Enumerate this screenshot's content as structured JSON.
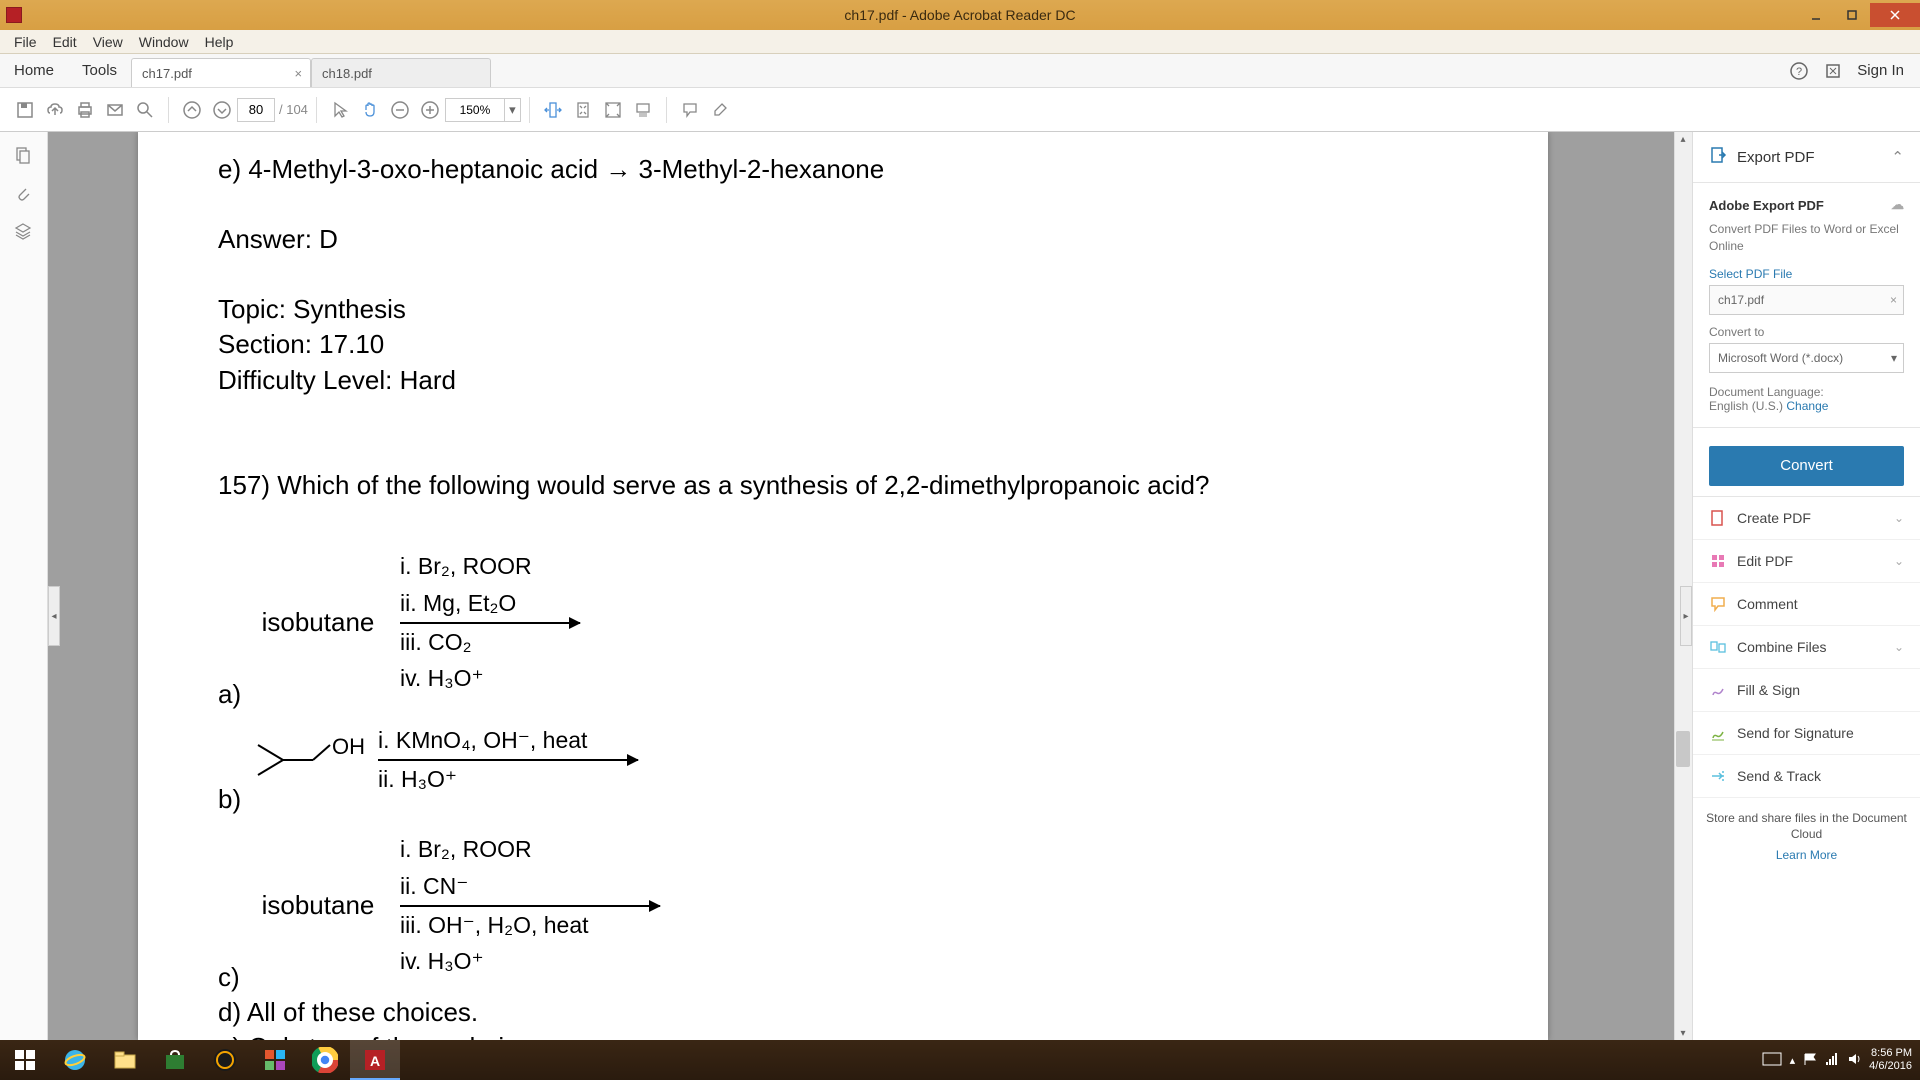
{
  "window": {
    "title": "ch17.pdf - Adobe Acrobat Reader DC"
  },
  "menubar": [
    "File",
    "Edit",
    "View",
    "Window",
    "Help"
  ],
  "tabs": {
    "home": "Home",
    "tools": "Tools",
    "docs": [
      {
        "label": "ch17.pdf",
        "active": true
      },
      {
        "label": "ch18.pdf",
        "active": false
      }
    ],
    "signin": "Sign In"
  },
  "toolbar": {
    "page_current": "80",
    "page_total": "/ 104",
    "zoom": "150%"
  },
  "document": {
    "line_e": "e) 4-Methyl-3-oxo-heptanoic acid  →  3-Methyl-2-hexanone",
    "answer": "Answer: D",
    "topic": "Topic: Synthesis",
    "section": "Section: 17.10",
    "difficulty": "Difficulty Level: Hard",
    "q157": "157) Which of the following would serve as a synthesis of 2,2-dimethylpropanoic acid?",
    "opt_a": {
      "label": "a)",
      "start": "isobutane",
      "steps_top": [
        "i. Br₂, ROOR",
        "ii. Mg, Et₂O"
      ],
      "steps_bot": [
        "iii. CO₂",
        "iv. H₃O⁺"
      ]
    },
    "opt_b": {
      "label": "b)",
      "oh": "OH",
      "steps_top": [
        "i. KMnO₄, OH⁻, heat"
      ],
      "steps_bot": [
        "ii. H₃O⁺"
      ]
    },
    "opt_c": {
      "label": "c)",
      "start": "isobutane",
      "steps_top": [
        "i.  Br₂, ROOR",
        "ii. CN⁻"
      ],
      "steps_bot": [
        "iii. OH⁻, H₂O, heat",
        "iv. H₃O⁺"
      ]
    },
    "opt_d": "d) All of these choices.",
    "opt_e": "e) Only two of these choices."
  },
  "rightpanel": {
    "export_header": "Export PDF",
    "export_title": "Adobe Export PDF",
    "export_sub": "Convert PDF Files to Word or Excel Online",
    "select_label": "Select PDF File",
    "selected_file": "ch17.pdf",
    "convert_to": "Convert to",
    "convert_format": "Microsoft Word (*.docx)",
    "doc_lang_label": "Document Language:",
    "doc_lang": "English (U.S.)",
    "change": "Change",
    "convert_btn": "Convert",
    "tools": [
      {
        "label": "Create PDF",
        "color": "#d9534f",
        "chev": true
      },
      {
        "label": "Edit PDF",
        "color": "#9b59b6",
        "chev": true
      },
      {
        "label": "Comment",
        "color": "#f0ad4e",
        "chev": false
      },
      {
        "label": "Combine Files",
        "color": "#5bc0de",
        "chev": true
      },
      {
        "label": "Fill & Sign",
        "color": "#9b59b6",
        "chev": false
      },
      {
        "label": "Send for Signature",
        "color": "#5bc0de",
        "chev": false
      },
      {
        "label": "Send & Track",
        "color": "#5bc0de",
        "chev": false
      }
    ],
    "cloud_promo": "Store and share files in the Document Cloud",
    "learn_more": "Learn More"
  },
  "taskbar": {
    "time": "8:56 PM",
    "date": "4/6/2016"
  }
}
